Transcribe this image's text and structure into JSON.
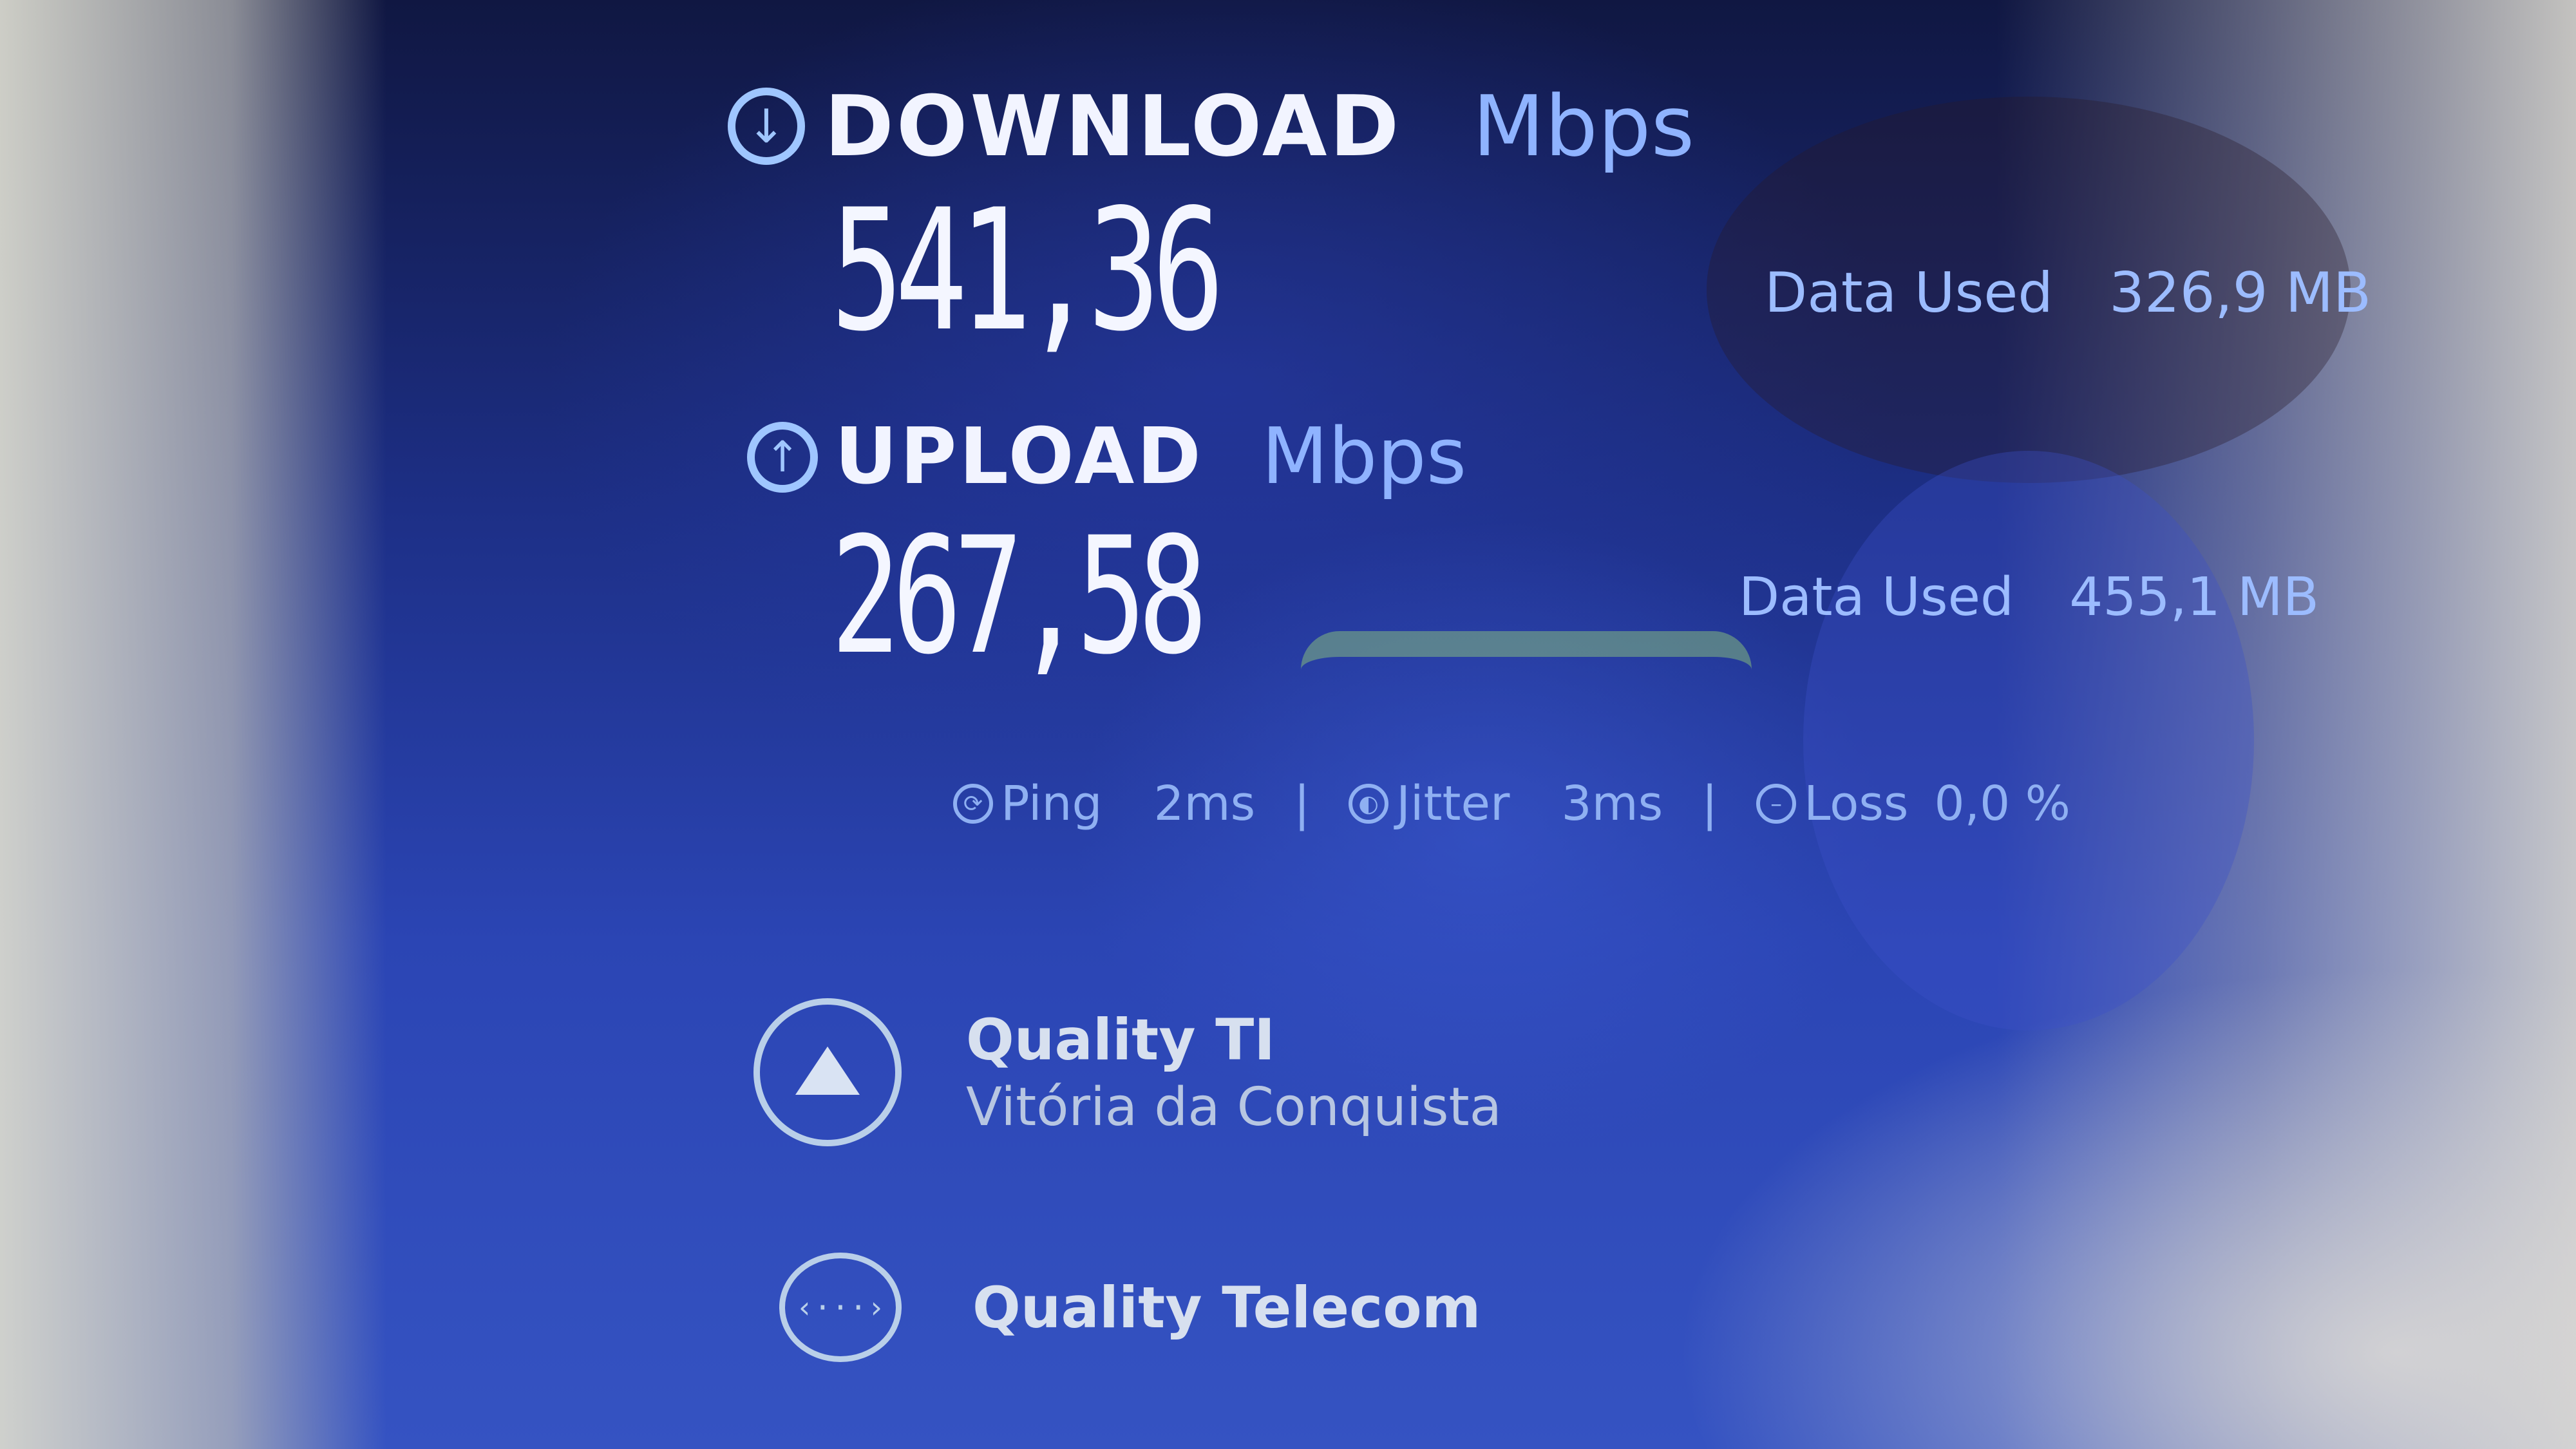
{
  "download": {
    "label": "DOWNLOAD",
    "unit": "Mbps",
    "value": "541,36",
    "data_used_label": "Data Used",
    "data_used_value": "326,9 MB",
    "icon": "arrow-down-circle-icon"
  },
  "upload": {
    "label": "UPLOAD",
    "unit": "Mbps",
    "value": "267,58",
    "data_used_label": "Data Used",
    "data_used_value": "455,1 MB",
    "icon": "arrow-up-circle-icon"
  },
  "stats": {
    "ping_label": "Ping",
    "ping_value": "2ms",
    "jitter_label": "Jitter",
    "jitter_value": "3ms",
    "loss_label": "Loss",
    "loss_value": "0,0 %",
    "separator": "|"
  },
  "server": {
    "name": "Quality TI",
    "city": "Vitória da Conquista",
    "icon": "server-triangle-icon"
  },
  "provider": {
    "name": "Quality Telecom",
    "icon": "connection-dots-icon"
  },
  "colors": {
    "background": "#1c2a6e",
    "accent": "#8fb3ff",
    "value_text": "#f4f6ff"
  }
}
